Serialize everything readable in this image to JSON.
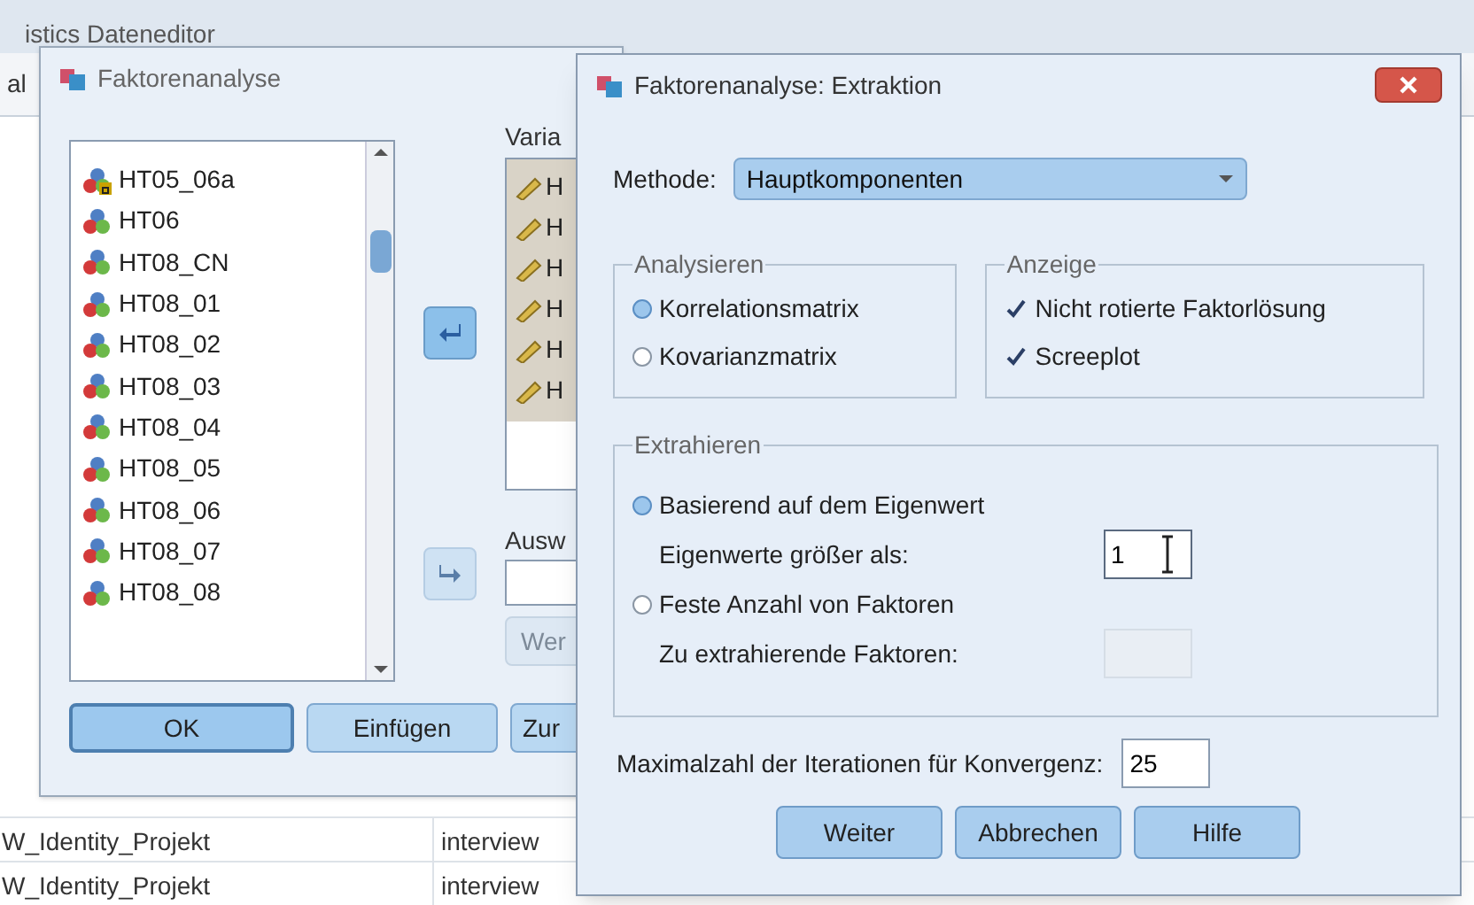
{
  "background_window": {
    "title": "istics Dateneditor",
    "menu_fragment": "al",
    "rows": [
      {
        "column_1": "W_Identity_Projekt",
        "column_2": "interview"
      },
      {
        "column_1": "W_Identity_Projekt",
        "column_2": "interview"
      }
    ]
  },
  "factor_dialog": {
    "title": "Faktorenanalyse",
    "variables": [
      {
        "name": "HT05_06a",
        "kind": "string"
      },
      {
        "name": "HT06",
        "kind": "nominal"
      },
      {
        "name": "HT08_CN",
        "kind": "nominal"
      },
      {
        "name": "HT08_01",
        "kind": "nominal"
      },
      {
        "name": "HT08_02",
        "kind": "nominal"
      },
      {
        "name": "HT08_03",
        "kind": "nominal"
      },
      {
        "name": "HT08_04",
        "kind": "nominal"
      },
      {
        "name": "HT08_05",
        "kind": "nominal"
      },
      {
        "name": "HT08_06",
        "kind": "nominal"
      },
      {
        "name": "HT08_07",
        "kind": "nominal"
      },
      {
        "name": "HT08_08",
        "kind": "nominal"
      }
    ],
    "variables_label": "Varia",
    "selected_variables": [
      {
        "name": "H"
      },
      {
        "name": "H"
      },
      {
        "name": "H"
      },
      {
        "name": "H"
      },
      {
        "name": "H"
      },
      {
        "name": "H"
      }
    ],
    "selection_label": "Ausw",
    "value_button": "Wer",
    "buttons": [
      {
        "label": "OK",
        "default": true
      },
      {
        "label": "Einfügen",
        "default": false
      },
      {
        "label": "Zur",
        "default": false
      }
    ]
  },
  "extraction_dialog": {
    "title": "Faktorenanalyse: Extraktion",
    "method_label": "Methode:",
    "method": "Hauptkomponenten",
    "analyze": {
      "title": "Analysieren",
      "options": [
        {
          "label": "Korrelationsmatrix",
          "selected": true
        },
        {
          "label": "Kovarianzmatrix",
          "selected": false
        }
      ]
    },
    "display": {
      "title": "Anzeige",
      "options": [
        {
          "label": "Nicht rotierte Faktorlösung",
          "checked": true
        },
        {
          "label": "Screeplot",
          "checked": true
        }
      ]
    },
    "extract": {
      "title": "Extrahieren",
      "options": [
        {
          "label": "Basierend auf dem Eigenwert",
          "selected": true,
          "field_label": "Eigenwerte größer als:",
          "field_value": "1",
          "field_disabled": false
        },
        {
          "label": "Feste Anzahl von Faktoren",
          "selected": false,
          "field_label": "Zu extrahierende Faktoren:",
          "field_disabled": true
        }
      ]
    },
    "iterations": {
      "label": "Maximalzahl der Iterationen für Konvergenz:",
      "value": "25"
    },
    "buttons": [
      {
        "label": "Weiter"
      },
      {
        "label": "Abbrechen"
      },
      {
        "label": "Hilfe"
      }
    ]
  }
}
